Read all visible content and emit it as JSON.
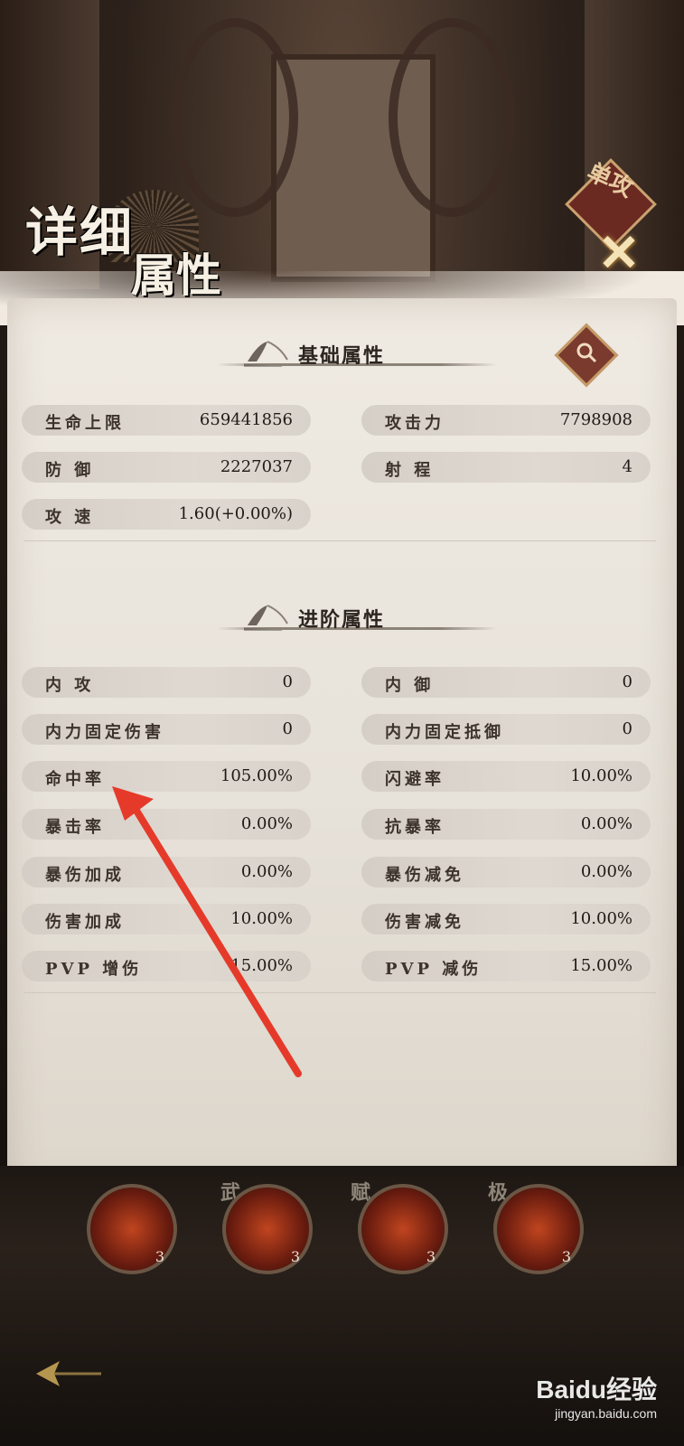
{
  "header": {
    "title_line1": "详细",
    "title_line2": "属性",
    "badge": "单攻"
  },
  "basic": {
    "section_title": "基础属性",
    "left": [
      {
        "label": "生命上限",
        "value": "659441856"
      },
      {
        "label": "防 御",
        "value": "2227037"
      },
      {
        "label": "攻 速",
        "value": "1.60(+0.00%)"
      }
    ],
    "right": [
      {
        "label": "攻击力",
        "value": "7798908"
      },
      {
        "label": "射 程",
        "value": "4"
      }
    ]
  },
  "advanced": {
    "section_title": "进阶属性",
    "left": [
      {
        "label": "内 攻",
        "value": "0"
      },
      {
        "label": "内力固定伤害",
        "value": "0"
      },
      {
        "label": "命中率",
        "value": "105.00%"
      },
      {
        "label": "暴击率",
        "value": "0.00%"
      },
      {
        "label": "暴伤加成",
        "value": "0.00%"
      },
      {
        "label": "伤害加成",
        "value": "10.00%"
      },
      {
        "label": "PVP 增伤",
        "value": "15.00%"
      }
    ],
    "right": [
      {
        "label": "内 御",
        "value": "0"
      },
      {
        "label": "内力固定抵御",
        "value": "0"
      },
      {
        "label": "闪避率",
        "value": "10.00%"
      },
      {
        "label": "抗暴率",
        "value": "0.00%"
      },
      {
        "label": "暴伤减免",
        "value": "0.00%"
      },
      {
        "label": "伤害减免",
        "value": "10.00%"
      },
      {
        "label": "PVP 减伤",
        "value": "15.00%"
      }
    ]
  },
  "skills": [
    {
      "tag": "",
      "level": "3"
    },
    {
      "tag": "武",
      "level": "3"
    },
    {
      "tag": "赋",
      "level": "3"
    },
    {
      "tag": "极",
      "level": "3"
    }
  ],
  "watermark": {
    "brand": "Baidu经验",
    "url": "jingyan.baidu.com"
  },
  "colors": {
    "panel": "#ebe6de",
    "accent_red": "#e53a2a",
    "row_bg": "#d8d2ca"
  },
  "icons": {
    "search": "search-icon",
    "close": "close-icon",
    "back": "back-arrow-icon"
  }
}
